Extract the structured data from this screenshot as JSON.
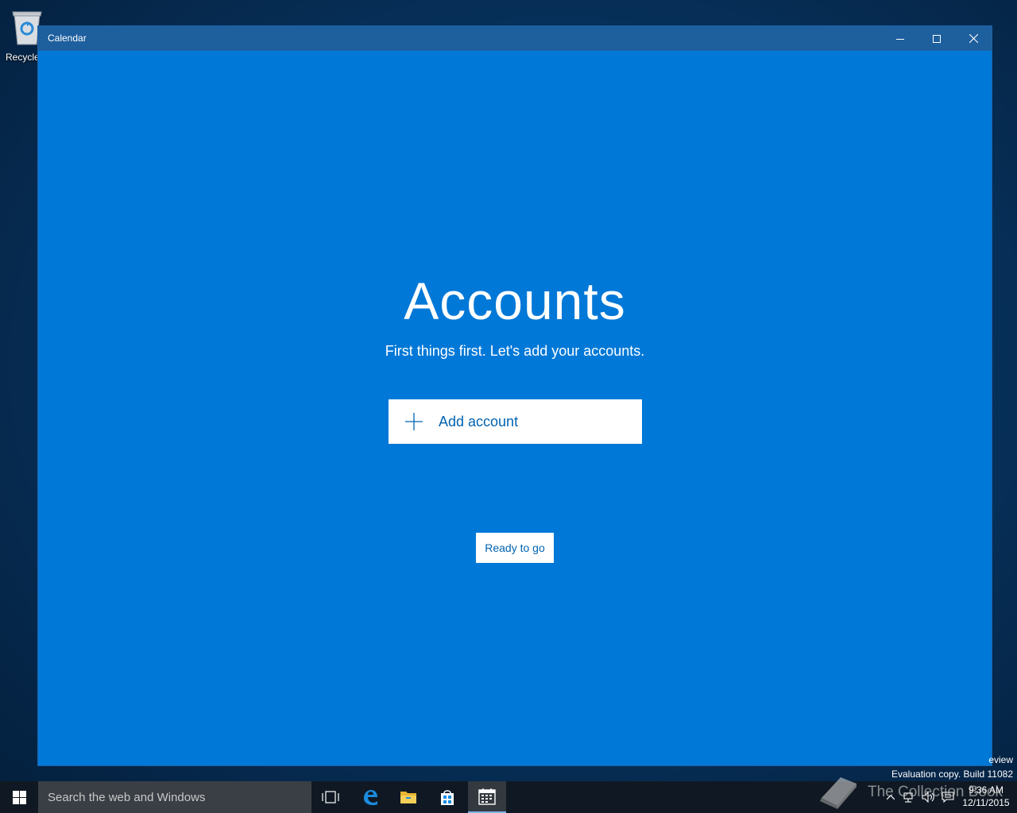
{
  "desktop": {
    "recycle_bin_label": "Recycle"
  },
  "window": {
    "title": "Calendar",
    "buttons": {
      "minimize": "minimize-icon",
      "maximize": "maximize-icon",
      "close": "close-icon"
    },
    "background_color": "#0078d7",
    "titlebar_color": "#1e5f9e"
  },
  "accounts": {
    "heading": "Accounts",
    "subtitle": "First things first. Let's add your accounts.",
    "add_account_label": "Add account",
    "ready_label": "Ready to go"
  },
  "system_text": {
    "preview_fragment": "eview",
    "evaluation": "Evaluation copy. Build 11082"
  },
  "taskbar": {
    "search_placeholder": "Search the web and Windows",
    "pinned": [
      "task-view-icon",
      "edge-icon",
      "file-explorer-icon",
      "store-icon",
      "calendar-icon"
    ],
    "active_app": "calendar-icon",
    "time": "9:36 AM",
    "date": "12/11/2015"
  },
  "watermark": {
    "text": "The Collection Book"
  }
}
